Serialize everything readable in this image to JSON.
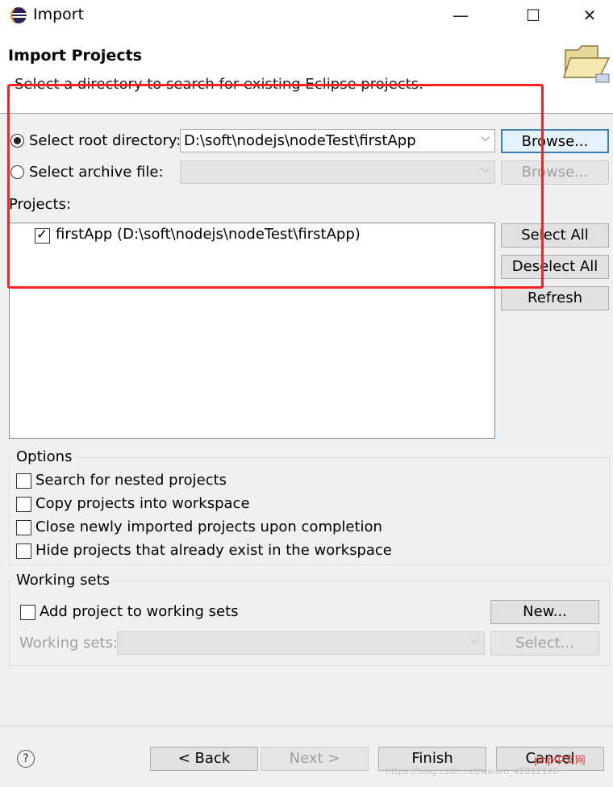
{
  "window": {
    "title": "Import",
    "icon": "eclipse-icon",
    "controls": {
      "minimize": "—",
      "maximize": "☐",
      "close": "✕"
    }
  },
  "header": {
    "title": "Import Projects",
    "description": "Select a directory to search for existing Eclipse projects.",
    "icon": "folder-open-icon"
  },
  "source": {
    "root_label": "Select root directory:",
    "root_value": "D:\\soft\\nodejs\\nodeTest\\firstApp",
    "root_browse": "Browse...",
    "archive_label": "Select archive file:",
    "archive_value": "",
    "archive_browse": "Browse..."
  },
  "projects": {
    "label": "Projects:",
    "items": [
      {
        "label": "firstApp (D:\\soft\\nodejs\\nodeTest\\firstApp)",
        "checked": true
      }
    ],
    "select_all": "Select All",
    "deselect_all": "Deselect All",
    "refresh": "Refresh"
  },
  "options": {
    "legend": "Options",
    "items": [
      {
        "label": "Search for nested projects",
        "checked": false
      },
      {
        "label": "Copy projects into workspace",
        "checked": false
      },
      {
        "label": "Close newly imported projects upon completion",
        "checked": false
      },
      {
        "label": "Hide projects that already exist in the workspace",
        "checked": false
      }
    ]
  },
  "working_sets": {
    "legend": "Working sets",
    "add_label": "Add project to working sets",
    "new_button": "New...",
    "sets_label": "Working sets:",
    "sets_value": "",
    "select_button": "Select..."
  },
  "footer": {
    "help": "?",
    "back": "< Back",
    "next": "Next >",
    "finish": "Finish",
    "cancel": "Cancel",
    "watermark": "https://blog.csdn.net/weixin_42812176",
    "logo_text": "php中文网"
  },
  "colors": {
    "annotation": "#ff2020",
    "focus_border": "#3c7fb1"
  }
}
